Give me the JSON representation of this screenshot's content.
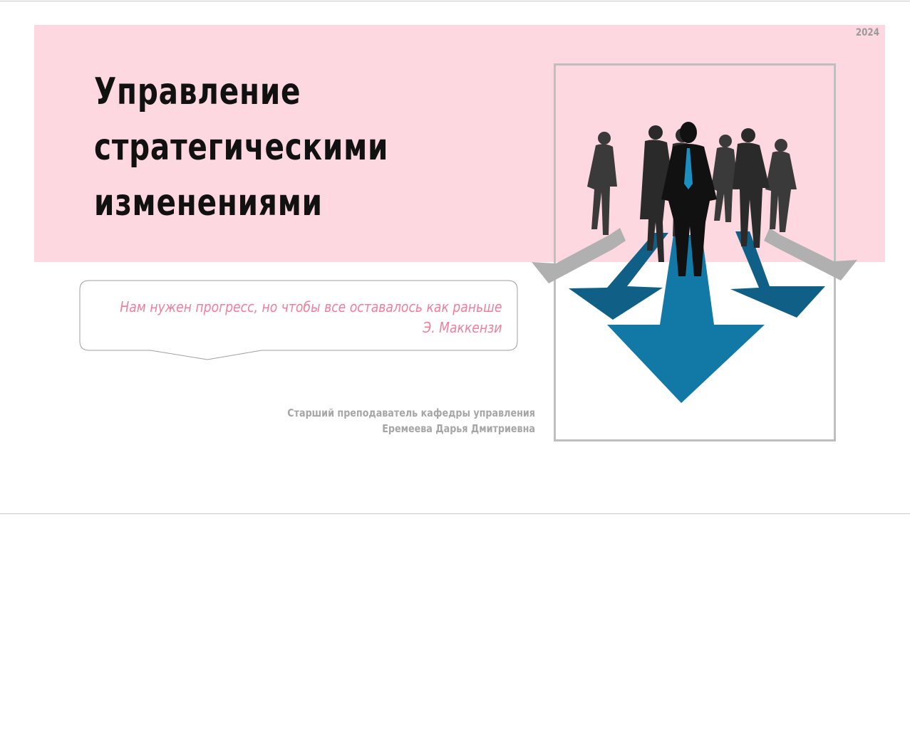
{
  "slide": {
    "year": "2024",
    "title_lines": [
      "Управление",
      "стратегическими",
      "изменениями"
    ],
    "quote": {
      "text": "Нам нужен прогресс, но чтобы все оставалось как раньше",
      "attribution": "Э. Маккензи"
    },
    "author": {
      "position": "Старший преподаватель кафедры управления",
      "name": "Еремеева Дарья Дмитриевна"
    },
    "illustration": {
      "icon": "business-people-arrows-illustration",
      "colors": {
        "arrow_main": "#1278a6",
        "arrow_side": "#0f5f86",
        "arrow_gray": "#b0b0b0",
        "silhouette": "#1a1a1a",
        "tie": "#1a8fc0"
      }
    },
    "colors": {
      "band": "#fdd8e1",
      "quote": "#ef7f9a",
      "muted": "#a6a6a6"
    }
  }
}
